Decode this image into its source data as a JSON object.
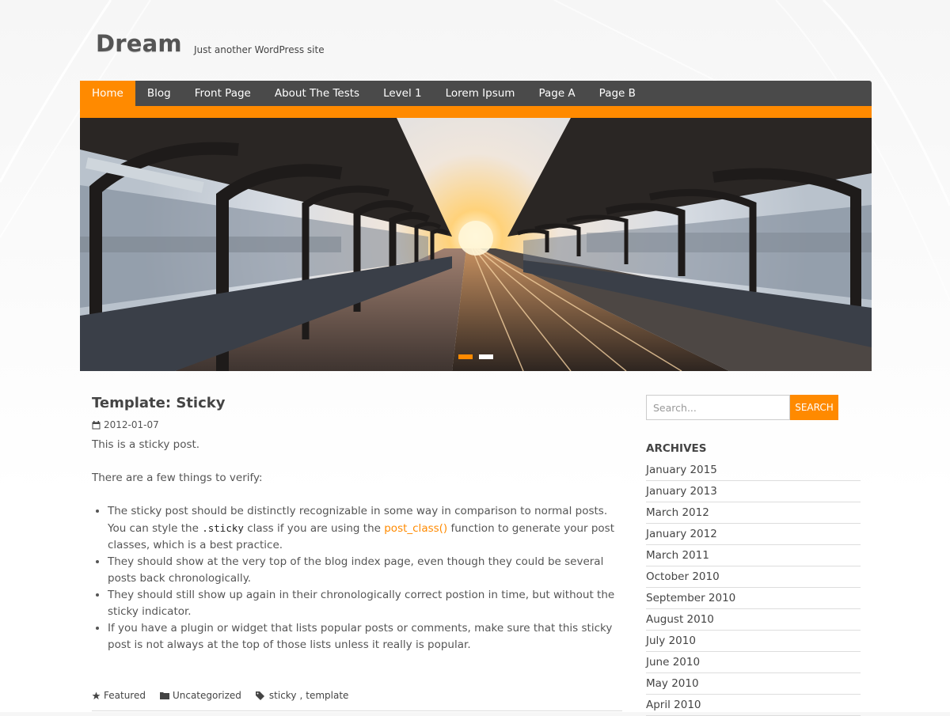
{
  "site": {
    "title": "Dream",
    "description": "Just another WordPress site"
  },
  "nav": {
    "items": [
      "Home",
      "Blog",
      "Front Page",
      "About The Tests",
      "Level 1",
      "Lorem Ipsum",
      "Page A",
      "Page B"
    ],
    "active": "Home"
  },
  "slider": {
    "image": "train-station-platform-sunset",
    "slide_count": 2,
    "active_slide": 1
  },
  "post": {
    "title": "Template: Sticky",
    "date": "2012-01-07",
    "intro": "This is a sticky post.",
    "verify": "There are a few things to verify:",
    "bullets": {
      "b1_pre": "The sticky post should be distinctly recognizable in some way in comparison to normal posts. You can style the ",
      "b1_code": ".sticky",
      "b1_mid": " class if you are using the ",
      "b1_link": "post_class()",
      "b1_post": " function to generate your post classes, which is a best practice.",
      "b2": "They should show at the very top of the blog index page, even though they could be several posts back chronologically.",
      "b3": "They should still show up again in their chronologically correct postion in time, but without the sticky indicator.",
      "b4": "If you have a plugin or widget that lists popular posts or comments, make sure that this sticky post is not always at the top of those lists unless it really is popular."
    },
    "meta": {
      "featured": "Featured",
      "category": "Uncategorized",
      "tag1": "sticky",
      "tag_sep": " , ",
      "tag2": "template"
    }
  },
  "sidebar": {
    "search_placeholder": "Search...",
    "search_button": "SEARCH",
    "archives_title": "ARCHIVES",
    "archives": [
      "January 2015",
      "January 2013",
      "March 2012",
      "January 2012",
      "March 2011",
      "October 2010",
      "September 2010",
      "August 2010",
      "July 2010",
      "June 2010",
      "May 2010",
      "April 2010"
    ]
  },
  "colors": {
    "accent": "#ff8a00",
    "nav_bg": "#4a4a4a"
  }
}
